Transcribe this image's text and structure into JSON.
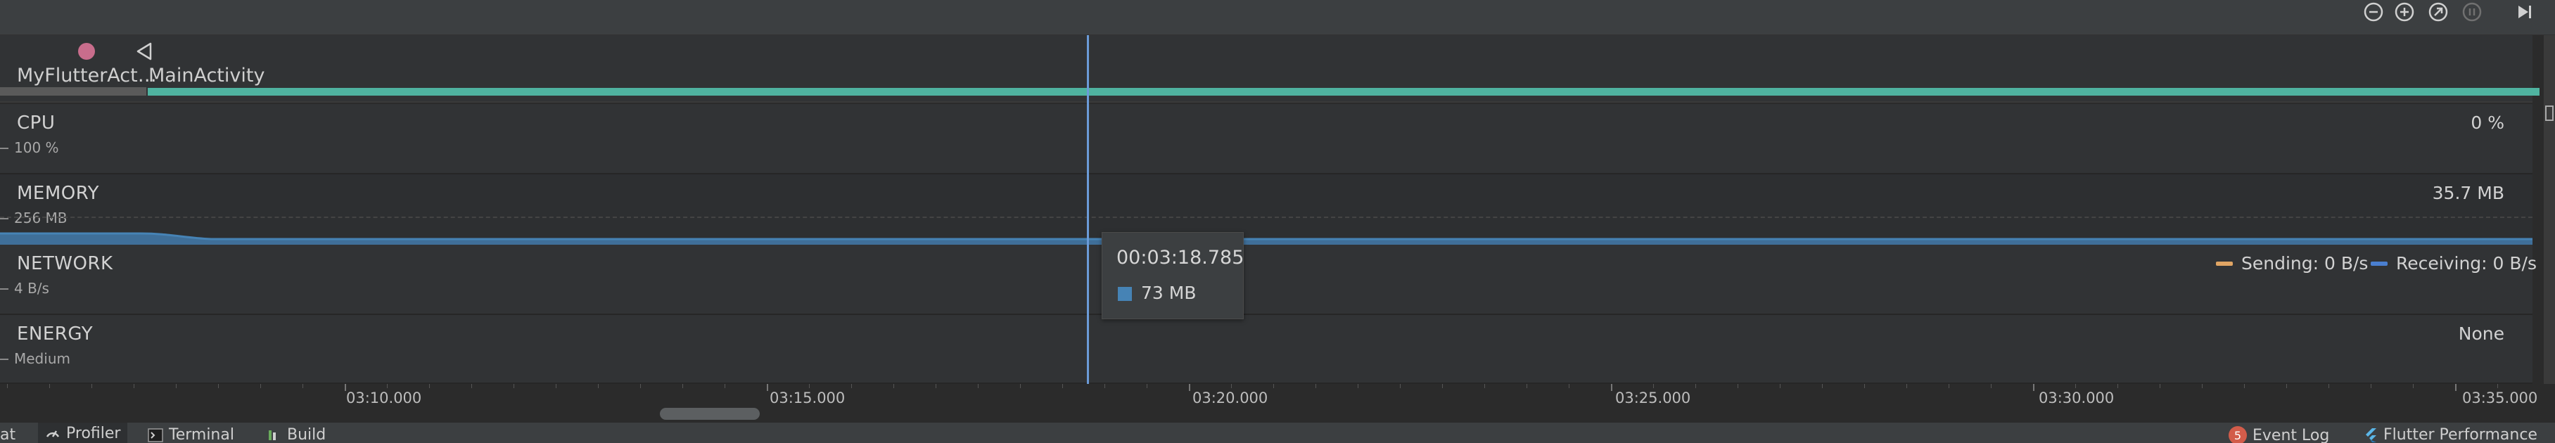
{
  "activity": {
    "first_label": "MyFlutterAct…",
    "second_label": "MainActivity"
  },
  "monitors": {
    "cpu": {
      "title": "CPU",
      "scale": "100 %",
      "value": "0 %"
    },
    "memory": {
      "title": "MEMORY",
      "scale": "256 MB",
      "value": "35.7 MB"
    },
    "network": {
      "title": "NETWORK",
      "scale": "4 B/s",
      "sending": "Sending: 0 B/s",
      "receiving": "Receiving: 0 B/s"
    },
    "energy": {
      "title": "ENERGY",
      "scale": "Medium",
      "value": "None"
    }
  },
  "axis": {
    "labels": [
      "03:10.000",
      "03:15.000",
      "03:20.000",
      "03:25.000",
      "03:30.000",
      "03:35.000"
    ]
  },
  "tooltip": {
    "time": "00:03:18.785",
    "value": "73 MB"
  },
  "toolbar": {
    "icons": [
      "zoom-out-icon",
      "zoom-in-icon",
      "reset-zoom-icon",
      "pause-icon",
      "go-live-icon"
    ]
  },
  "bottom_bar": {
    "left_fragment": "at",
    "profiler": "Profiler",
    "terminal": "Terminal",
    "build": "Build",
    "event_count": "5",
    "event_log": "Event Log",
    "flutter_performance": "Flutter Performance"
  },
  "colors": {
    "activity_green": "#4fb3a0",
    "memory_blue": "#4683b5",
    "sending_orange": "#e0a564",
    "receiving_blue": "#4a7fd0",
    "cursor": "#6b9bd8",
    "dot": "#c86d8c"
  }
}
